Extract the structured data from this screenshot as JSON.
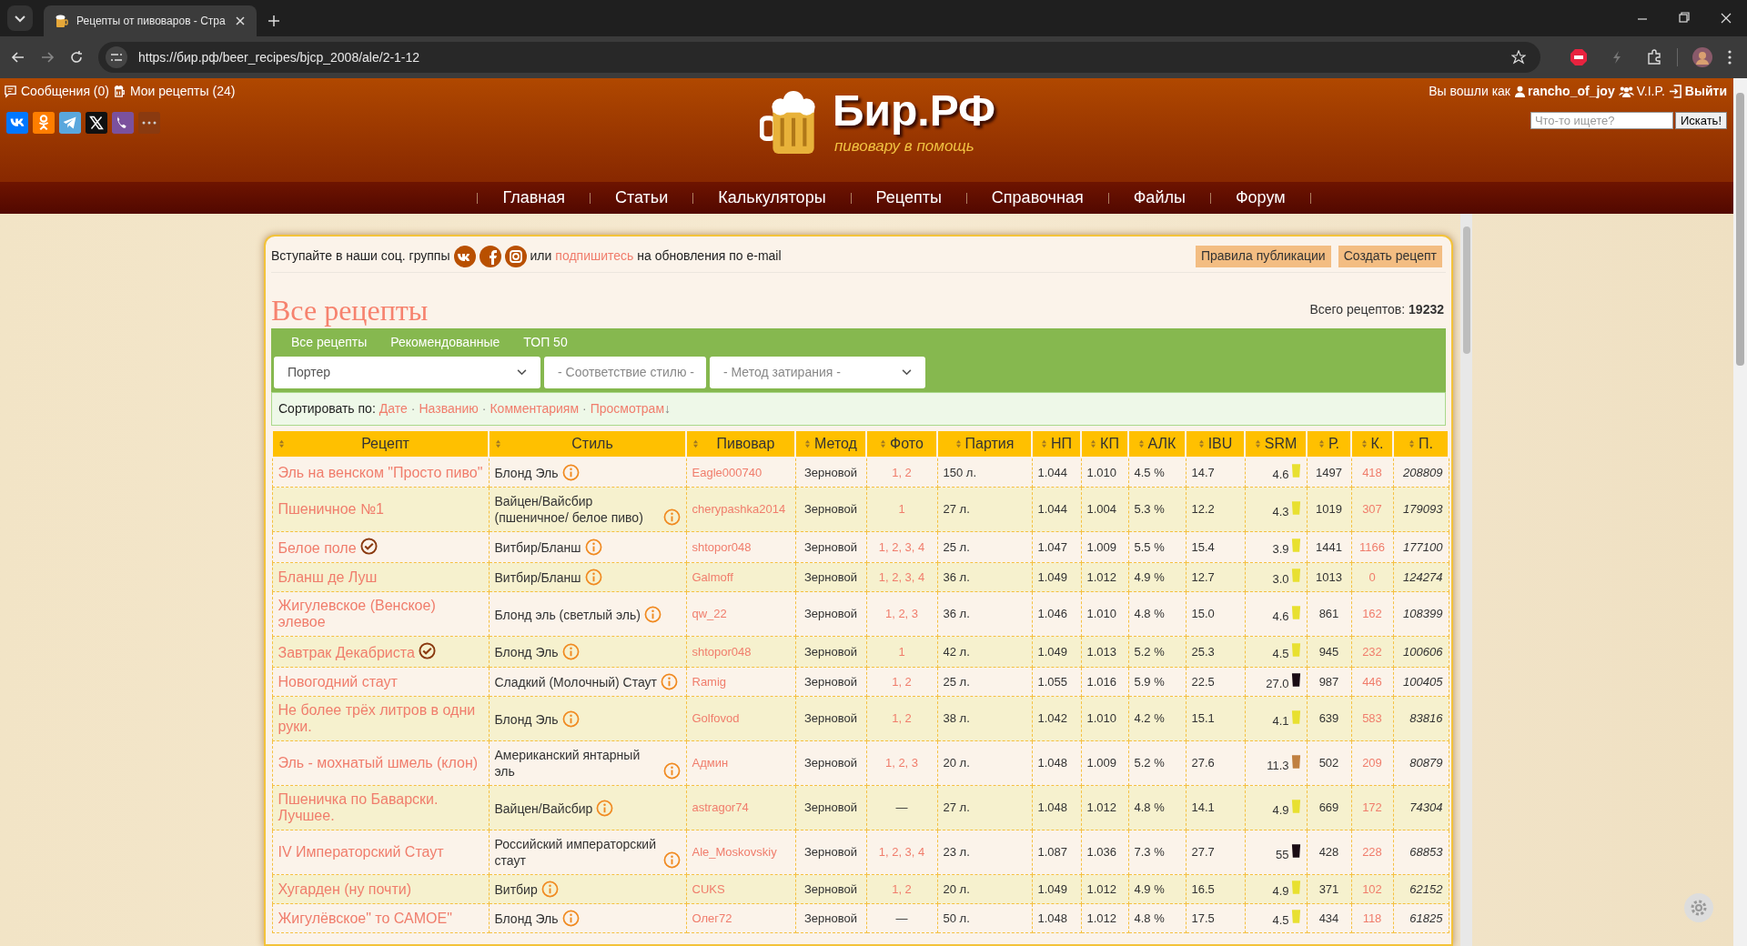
{
  "browser": {
    "tabs": [
      {
        "title": "Рецепты от пивоваров - Стра",
        "selected": true
      }
    ],
    "url": "https://бир.рф/beer_recipes/bjcp_2008/ale/2-1-12"
  },
  "header": {
    "user_links": [
      {
        "kind": "messages",
        "text": "Сообщения (0)"
      },
      {
        "kind": "recipes",
        "text": "Мои рецепты (24)"
      }
    ],
    "logo": {
      "title": "Бир.РФ",
      "tagline": "пивовару в помощь"
    },
    "login": {
      "prefix": "Вы вошли как",
      "username": "rancho_of_joy",
      "group": "V.I.P.",
      "logout": "Выйти"
    },
    "search": {
      "placeholder": "Что-то ищете?",
      "button": "Искать!"
    },
    "nav": [
      "Главная",
      "Статьи",
      "Калькуляторы",
      "Рецепты",
      "Справочная",
      "Файлы",
      "Форум"
    ]
  },
  "notice": {
    "before": "Вступайте в наши соц. группы",
    "middle": "или",
    "link": "подпишитесь",
    "after": "на обновления по e-mail"
  },
  "actions": [
    "Правила публикации",
    "Создать рецепт"
  ],
  "title": "Все рецепты",
  "total": {
    "label": "Всего рецептов:",
    "value": "19232"
  },
  "tabs": [
    "Все рецепты",
    "Рекомендованные",
    "ТОП 50"
  ],
  "filters": [
    {
      "value": "Портер"
    },
    {
      "placeholder": "- Соответствие стилю -"
    },
    {
      "placeholder": "- Метод затирания -"
    }
  ],
  "sort": {
    "label": "Сортировать по:",
    "separator": "·",
    "options": [
      {
        "label": "Дате"
      },
      {
        "label": "Названию"
      },
      {
        "label": "Комментариям"
      },
      {
        "label": "Просмотрам",
        "arrow": "↓"
      }
    ]
  },
  "table": {
    "columns": [
      "Рецепт",
      "Стиль",
      "Пивовар",
      "Метод",
      "Фото",
      "Партия",
      "НП",
      "КП",
      "АЛК",
      "IBU",
      "SRM",
      "Р.",
      "К.",
      "П."
    ],
    "rows": [
      {
        "recipe": "Эль на венском \"Просто пиво\"",
        "approved": false,
        "style": "Блонд Эль",
        "brewer": "Eagle000740",
        "method": "Зерновой",
        "photos": "1, 2",
        "has_photos": true,
        "batch": "150 л.",
        "og": "1.044",
        "fg": "1.010",
        "abv": "4.5 %",
        "ibu": "14.7",
        "srm": "4.6",
        "color": "#e8e030",
        "rating": "1497",
        "comments": "418",
        "views": "208809"
      },
      {
        "recipe": "Пшеничное №1",
        "approved": false,
        "style": "Вайцен/Вайсбир (пшеничное/ белое пиво)",
        "brewer": "cherypashka2014",
        "method": "Зерновой",
        "photos": "1",
        "has_photos": true,
        "batch": "27 л.",
        "og": "1.044",
        "fg": "1.004",
        "abv": "5.3 %",
        "ibu": "12.2",
        "srm": "4.3",
        "color": "#e8e030",
        "rating": "1019",
        "comments": "307",
        "views": "179093"
      },
      {
        "recipe": "Белое поле",
        "approved": true,
        "style": "Витбир/Бланш",
        "brewer": "shtopor048",
        "method": "Зерновой",
        "photos": "1, 2, 3, 4",
        "has_photos": true,
        "batch": "25 л.",
        "og": "1.047",
        "fg": "1.009",
        "abv": "5.5 %",
        "ibu": "15.4",
        "srm": "3.9",
        "color": "#e8e030",
        "rating": "1441",
        "comments": "1166",
        "views": "177100"
      },
      {
        "recipe": "Бланш де Луш",
        "approved": false,
        "style": "Витбир/Бланш",
        "brewer": "Galmoff",
        "method": "Зерновой",
        "photos": "1, 2, 3, 4",
        "has_photos": true,
        "batch": "36 л.",
        "og": "1.049",
        "fg": "1.012",
        "abv": "4.9 %",
        "ibu": "12.7",
        "srm": "3.0",
        "color": "#e8e030",
        "rating": "1013",
        "comments": "0",
        "views": "124274"
      },
      {
        "recipe": "Жигулевское (Венское) элевое",
        "approved": false,
        "style": "Блонд эль (светлый эль)",
        "brewer": "qw_22",
        "method": "Зерновой",
        "photos": "1, 2, 3",
        "has_photos": true,
        "batch": "36 л.",
        "og": "1.046",
        "fg": "1.010",
        "abv": "4.8 %",
        "ibu": "15.0",
        "srm": "4.6",
        "color": "#e8e030",
        "rating": "861",
        "comments": "162",
        "views": "108399"
      },
      {
        "recipe": "Завтрак Декабриста",
        "approved": true,
        "style": "Блонд Эль",
        "brewer": "shtopor048",
        "method": "Зерновой",
        "photos": "1",
        "has_photos": true,
        "batch": "42 л.",
        "og": "1.049",
        "fg": "1.013",
        "abv": "5.2 %",
        "ibu": "25.3",
        "srm": "4.5",
        "color": "#e8e030",
        "rating": "945",
        "comments": "232",
        "views": "100606"
      },
      {
        "recipe": "Новогодний стаут",
        "approved": false,
        "style": "Сладкий (Молочный) Стаут",
        "brewer": "Ramig",
        "method": "Зерновой",
        "photos": "1, 2",
        "has_photos": true,
        "batch": "25 л.",
        "og": "1.055",
        "fg": "1.016",
        "abv": "5.9 %",
        "ibu": "22.5",
        "srm": "27.0",
        "color": "#1a0c14",
        "rating": "987",
        "comments": "446",
        "views": "100405"
      },
      {
        "recipe": "Не более трёх литров в одни руки.",
        "approved": false,
        "style": "Блонд Эль",
        "brewer": "Golfovod",
        "method": "Зерновой",
        "photos": "1, 2",
        "has_photos": true,
        "batch": "38 л.",
        "og": "1.042",
        "fg": "1.010",
        "abv": "4.2 %",
        "ibu": "15.1",
        "srm": "4.1",
        "color": "#e8e030",
        "rating": "639",
        "comments": "583",
        "views": "83816"
      },
      {
        "recipe": "Эль - мохнатый шмель (клон)",
        "approved": false,
        "style": "Американский янтарный эль",
        "brewer": "Админ",
        "method": "Зерновой",
        "photos": "1, 2, 3",
        "has_photos": true,
        "batch": "20 л.",
        "og": "1.048",
        "fg": "1.009",
        "abv": "5.2 %",
        "ibu": "27.6",
        "srm": "11.3",
        "color": "#c08040",
        "rating": "502",
        "comments": "209",
        "views": "80879"
      },
      {
        "recipe": "Пшеничка по Баварски. Лучшее.",
        "approved": false,
        "style": "Вайцен/Вайсбир",
        "brewer": "astragor74",
        "method": "Зерновой",
        "photos": "—",
        "has_photos": false,
        "batch": "27 л.",
        "og": "1.048",
        "fg": "1.012",
        "abv": "4.8 %",
        "ibu": "14.1",
        "srm": "4.9",
        "color": "#e8e030",
        "rating": "669",
        "comments": "172",
        "views": "74304"
      },
      {
        "recipe": "IV Императорский Стаут",
        "approved": false,
        "style": "Российский императорский стаут",
        "brewer": "Ale_Moskovskiy",
        "method": "Зерновой",
        "photos": "1, 2, 3, 4",
        "has_photos": true,
        "batch": "23 л.",
        "og": "1.087",
        "fg": "1.036",
        "abv": "7.3 %",
        "ibu": "27.7",
        "srm": "55",
        "color": "#1a0c14",
        "rating": "428",
        "comments": "228",
        "views": "68853"
      },
      {
        "recipe": "Хугарден (ну почти)",
        "approved": false,
        "style": "Витбир",
        "brewer": "CUKS",
        "method": "Зерновой",
        "photos": "1, 2",
        "has_photos": true,
        "batch": "20 л.",
        "og": "1.049",
        "fg": "1.012",
        "abv": "4.9 %",
        "ibu": "16.5",
        "srm": "4.9",
        "color": "#e8e030",
        "rating": "371",
        "comments": "102",
        "views": "62152"
      },
      {
        "recipe": "Жигулёвское\" то САМОЕ\"",
        "approved": false,
        "style": "Блонд Эль",
        "brewer": "Олег72",
        "method": "Зерновой",
        "photos": "—",
        "has_photos": false,
        "batch": "50 л.",
        "og": "1.048",
        "fg": "1.012",
        "abv": "4.8 %",
        "ibu": "17.5",
        "srm": "4.5",
        "color": "#e8e030",
        "rating": "434",
        "comments": "118",
        "views": "61825"
      }
    ]
  }
}
